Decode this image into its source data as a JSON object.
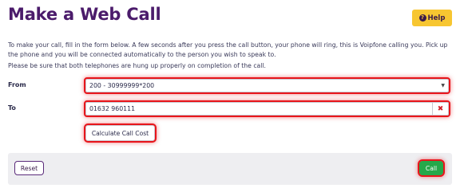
{
  "page": {
    "title": "Make a Web Call"
  },
  "help": {
    "icon": "question-circle-icon",
    "label": "Help"
  },
  "intro": {
    "line1": "To make your call, fill in the form below. A few seconds after you press the call button, your phone will ring, this is Voipfone calling you. Pick up the phone and you will be connected automatically to the person you wish to speak to.",
    "line2": "Please be sure that both telephones are hung up properly on completion of the call."
  },
  "form": {
    "from_label": "From",
    "from_value": "200 - 30999999*200",
    "to_label": "To",
    "to_value": "01632 960111",
    "calc_label": "Calculate Call Cost"
  },
  "footer": {
    "reset_label": "Reset",
    "call_label": "Call"
  },
  "colors": {
    "title": "#4b1b6b",
    "help_bg": "#f7c631",
    "highlight": "#e8151b",
    "call_bg": "#26a84a",
    "clear_icon": "#d0202a"
  }
}
